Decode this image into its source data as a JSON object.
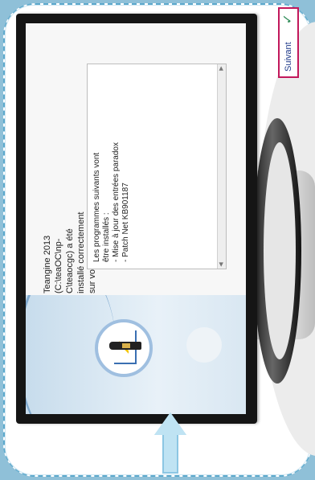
{
  "installer": {
    "message": "Teangine 2013 (C:\\teaOC\\np-C\\teaocgc) a été installé correctement sur votre système.",
    "programs_header": "Les programmes suivants vont être installés :",
    "programs": [
      "- Mise à jour des entrées paradox",
      "- Patch Net KB901187"
    ]
  },
  "buttons": {
    "next_label": "Suivant",
    "next_icon": "check-icon"
  },
  "colors": {
    "highlight_border": "#c2185b",
    "next_text": "#1f3a8a",
    "check": "#2e8b57",
    "dashed_border": "#5da9cc"
  }
}
